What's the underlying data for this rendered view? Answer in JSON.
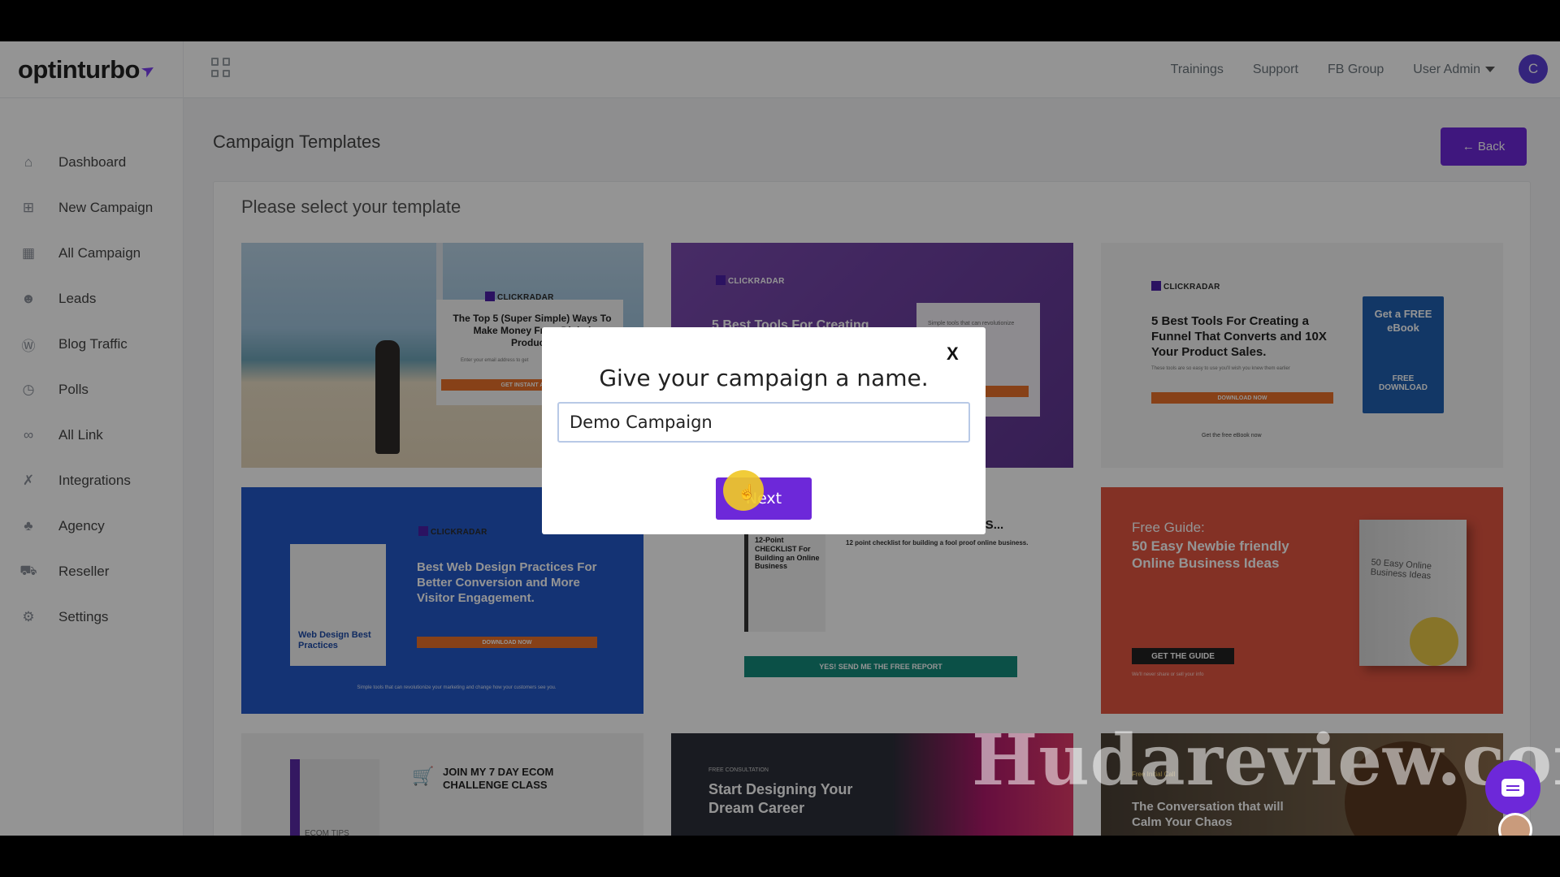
{
  "header": {
    "logo": "optinturbo",
    "nav": [
      "Trainings",
      "Support",
      "FB Group"
    ],
    "user_menu": "User Admin",
    "avatar_initial": "C"
  },
  "sidebar": {
    "items": [
      {
        "label": "Dashboard",
        "icon": "home-icon"
      },
      {
        "label": "New Campaign",
        "icon": "plus-square-icon"
      },
      {
        "label": "All Campaign",
        "icon": "table-icon"
      },
      {
        "label": "Leads",
        "icon": "users-icon"
      },
      {
        "label": "Blog Traffic",
        "icon": "wordpress-icon"
      },
      {
        "label": "Polls",
        "icon": "clock-icon"
      },
      {
        "label": "All Link",
        "icon": "link-icon"
      },
      {
        "label": "Integrations",
        "icon": "plug-icon"
      },
      {
        "label": "Agency",
        "icon": "building-icon"
      },
      {
        "label": "Reseller",
        "icon": "cart-icon"
      },
      {
        "label": "Settings",
        "icon": "gear-icon"
      }
    ]
  },
  "main": {
    "page_title": "Campaign Templates",
    "back_label": "← Back",
    "panel_title": "Please select your template"
  },
  "templates": [
    {
      "brand": "CLICKRADAR",
      "heading": "The Top 5 (Super Simple) Ways To Make Money From Digital Products",
      "sub": "Enter your email address to get",
      "cta": "GET INSTANT ACC"
    },
    {
      "brand": "CLICKRADAR",
      "heading": "5 Best Tools For Creating",
      "sub": "Simple tools that can revolutionize",
      "cta": "UP"
    },
    {
      "brand": "CLICKRADAR",
      "heading": "5 Best Tools For Creating a Funnel That Converts and 10X Your Product Sales.",
      "sub": "These tools are so easy to use you'll wish you knew them earlier",
      "cta": "DOWNLOAD NOW",
      "book_title": "Get a FREE eBook",
      "book_footer": "FREE DOWNLOAD",
      "footer": "Get the free eBook now"
    },
    {
      "brand": "CLICKRADAR",
      "heading": "Best Web Design Practices For Better Conversion and More Visitor Engagement.",
      "book_title": "Web Design Best Practices",
      "cta": "DOWNLOAD NOW",
      "footer": "Simple tools that can revolutionize your marketing and change how your customers see you."
    },
    {
      "heading": "FREE REPORT REVEALS...",
      "sub": "12 point checklist for building a fool proof online business.",
      "book_title": "12-Point CHECKLIST For Building an Online Business",
      "cta": "YES! SEND ME THE FREE REPORT"
    },
    {
      "kicker": "Free Guide:",
      "heading": "50 Easy Newbie friendly Online Business Ideas",
      "book_title": "50 Easy Online Business Ideas",
      "cta": "GET THE GUIDE",
      "footer": "We'll never share or sell your info"
    },
    {
      "heading": "JOIN MY 7 DAY ECOM CHALLENGE CLASS",
      "book_title": "ECOM TIPS"
    },
    {
      "kicker": "FREE CONSULTATION",
      "heading": "Start Designing Your Dream Career"
    },
    {
      "kicker": "Free Initial Call",
      "heading": "The Conversation that will Calm Your Chaos"
    }
  ],
  "modal": {
    "close_label": "X",
    "title": "Give your campaign a name.",
    "input_value": "Demo Campaign",
    "next_label": "Next"
  },
  "watermark": "Hudareview.com",
  "colors": {
    "accent": "#6d28d9",
    "overlay": "rgba(0,0,0,0.42)"
  }
}
